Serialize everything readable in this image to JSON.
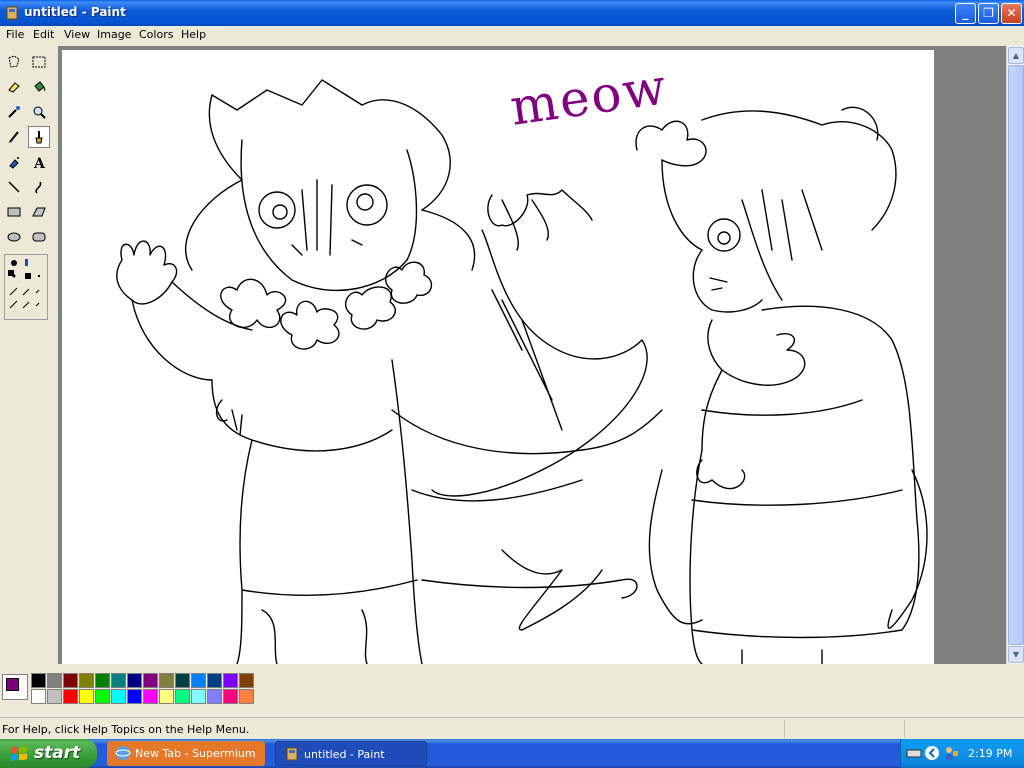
{
  "window": {
    "title": "untitled - Paint",
    "minimize_label": "_",
    "maximize_label": "❐",
    "close_label": "✕"
  },
  "menu": [
    "File",
    "Edit",
    "View",
    "Image",
    "Colors",
    "Help"
  ],
  "toolbox": {
    "tools": [
      "free-form-select",
      "select",
      "eraser",
      "fill-with-color",
      "pick-color",
      "magnifier",
      "pencil",
      "brush",
      "airbrush",
      "text",
      "line",
      "curve",
      "rectangle",
      "polygon",
      "ellipse",
      "rounded-rectangle"
    ],
    "selected_tool": "brush"
  },
  "canvas": {
    "handwritten_text": "meow"
  },
  "palette": {
    "foreground": "#800080",
    "background": "#ffffff",
    "top_row": [
      "#000000",
      "#808080",
      "#800000",
      "#808000",
      "#008000",
      "#008080",
      "#000080",
      "#800080",
      "#808040",
      "#004040",
      "#0080ff",
      "#004080",
      "#8000ff",
      "#804000"
    ],
    "bottom_row": [
      "#ffffff",
      "#c0c0c0",
      "#ff0000",
      "#ffff00",
      "#00ff00",
      "#00ffff",
      "#0000ff",
      "#ff00ff",
      "#ffff80",
      "#00ff80",
      "#80ffff",
      "#8080ff",
      "#ff0080",
      "#ff8040"
    ]
  },
  "statusbar": {
    "help_text": "For Help, click Help Topics on the Help Menu."
  },
  "taskbar": {
    "start_label": "start",
    "tasks": [
      {
        "label": "New Tab - Supermium",
        "icon": "browser-icon"
      },
      {
        "label": "untitled - Paint",
        "icon": "paint-icon"
      }
    ],
    "clock": "2:19 PM"
  }
}
